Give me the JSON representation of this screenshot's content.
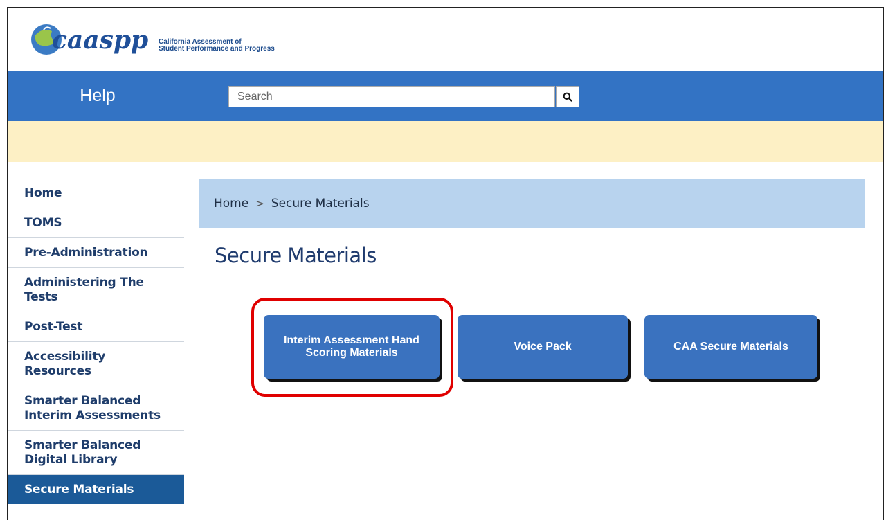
{
  "header": {
    "logo_text": "caaspp",
    "org_line1": "California Assessment of",
    "org_line2": "Student Performance and Progress"
  },
  "help_bar": {
    "title": "Help",
    "search_placeholder": "Search",
    "search_icon": "magnifier-icon"
  },
  "sidebar": {
    "items": [
      {
        "label": "Home"
      },
      {
        "label": "TOMS"
      },
      {
        "label": "Pre-Administration"
      },
      {
        "label": "Administering The Tests"
      },
      {
        "label": "Post-Test"
      },
      {
        "label": "Accessibility Resources"
      },
      {
        "label": "Smarter Balanced Interim Assessments"
      },
      {
        "label": "Smarter Balanced Digital Library"
      },
      {
        "label": "Secure Materials"
      }
    ],
    "active_index": 8
  },
  "breadcrumb": {
    "items": [
      "Home",
      "Secure Materials"
    ],
    "separator": ">"
  },
  "main": {
    "title": "Secure Materials",
    "tiles": [
      {
        "label": "Interim Assessment Hand Scoring Materials"
      },
      {
        "label": "Voice Pack"
      },
      {
        "label": "CAA Secure Materials"
      }
    ]
  },
  "colors": {
    "help_bar": "#3373c4",
    "notice_bar": "#fdf0c5",
    "breadcrumb_bg": "#b8d3ee",
    "tile_bg": "#3a72bf",
    "active_nav": "#1b5a98",
    "highlight": "#e00000"
  }
}
